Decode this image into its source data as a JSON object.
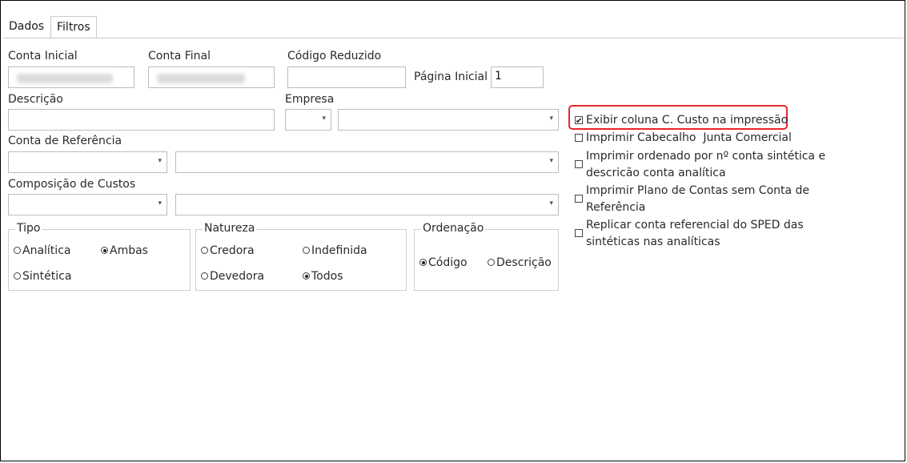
{
  "tabs": [
    {
      "label": "Dados"
    },
    {
      "label": "Filtros"
    }
  ],
  "labels": {
    "conta_inicial": "Conta Inicial",
    "conta_final": "Conta Final",
    "codigo_reduzido": "Código Reduzido",
    "pagina_inicial": "Página Inicial",
    "descricao": "Descrição",
    "empresa": "Empresa",
    "conta_referencia": "Conta de Referência",
    "composicao_custos": "Composição de Custos"
  },
  "fields": {
    "pagina_inicial_value": "1"
  },
  "groups": {
    "tipo": {
      "legend": "Tipo",
      "options": [
        "Analítica",
        "Ambas",
        "Sintética"
      ],
      "selected": "Ambas"
    },
    "natureza": {
      "legend": "Natureza",
      "options": [
        "Credora",
        "Indefinida",
        "Devedora",
        "Todos"
      ],
      "selected": "Todos"
    },
    "ordenacao": {
      "legend": "Ordenação",
      "options": [
        "Código",
        "Descrição"
      ],
      "selected": "Código"
    }
  },
  "checkboxes": [
    {
      "label": "Exibir coluna C. Custo na impressão",
      "checked": true
    },
    {
      "label": "Imprimir Cabecalho  Junta Comercial",
      "checked": false
    },
    {
      "label_line1": "Imprimir ordenado por nº conta sintética e",
      "label_line2": "descricão conta analítica",
      "checked": false
    },
    {
      "label_line1": "Imprimir Plano de Contas sem Conta de",
      "label_line2": "Referência",
      "checked": false
    },
    {
      "label_line1": "Replicar conta referencial do SPED das",
      "label_line2": "sintéticas nas analíticas",
      "checked": false
    }
  ],
  "colors": {
    "highlight": "#e8262c",
    "border": "#bcbcbc"
  },
  "icons": {
    "dropdown": "chevron-down-icon"
  }
}
